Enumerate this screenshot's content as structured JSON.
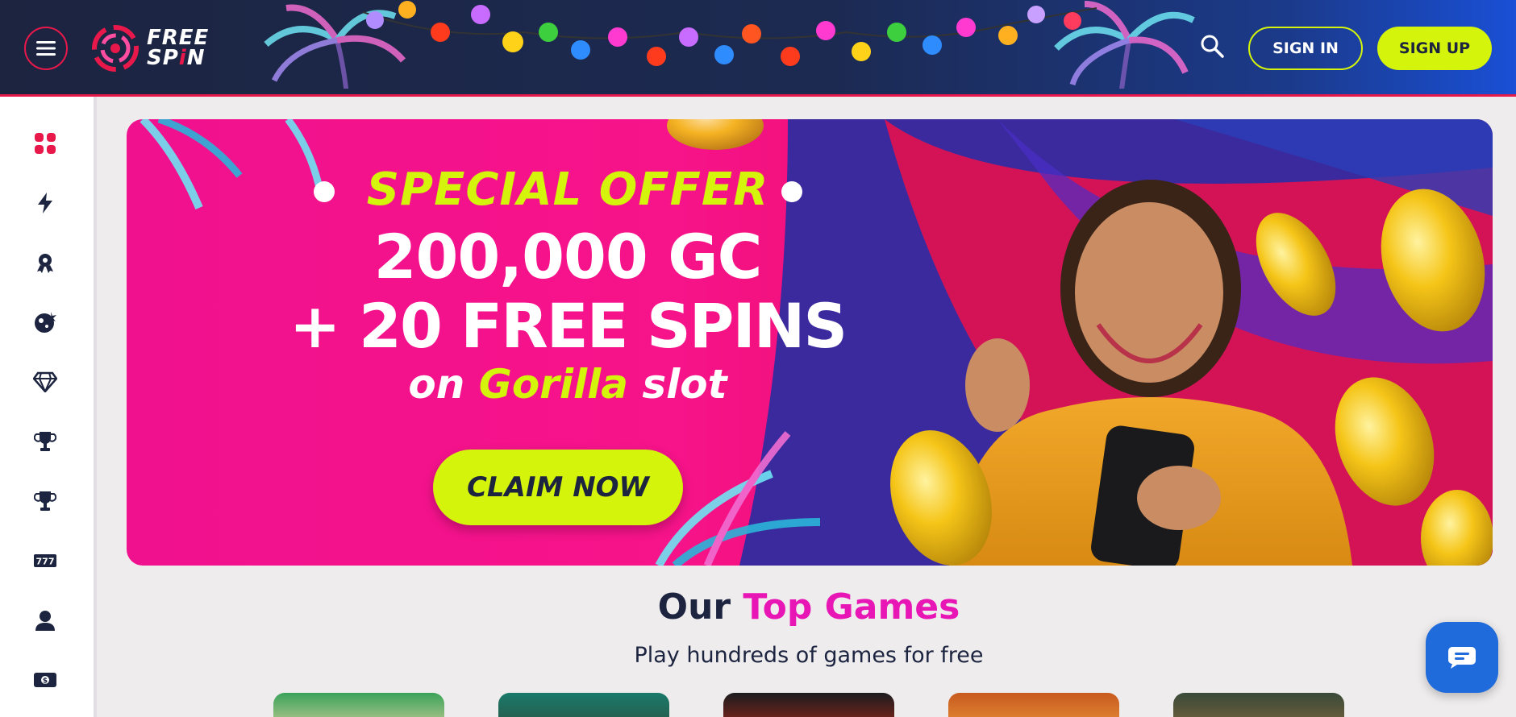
{
  "header": {
    "logo_line1": "FREE",
    "logo_line2_a": "SP",
    "logo_line2_b": "i",
    "logo_line2_c": "N",
    "menu_icon": "hamburger-icon",
    "search_icon": "search-icon",
    "signin_label": "SIGN IN",
    "signup_label": "SIGN UP"
  },
  "sidebar": {
    "items": [
      {
        "icon": "grid-icon",
        "color": "#e8184a"
      },
      {
        "icon": "lightning-icon",
        "color": "#1c2440"
      },
      {
        "icon": "award-ribbon-icon",
        "color": "#1c2440"
      },
      {
        "icon": "crazy-ball-icon",
        "color": "#1c2440"
      },
      {
        "icon": "diamond-icon",
        "color": "#1c2440"
      },
      {
        "icon": "trophy-icon",
        "color": "#1c2440"
      },
      {
        "icon": "trophy-icon",
        "color": "#1c2440"
      },
      {
        "icon": "slots-777-icon",
        "color": "#1c2440"
      },
      {
        "icon": "user-icon",
        "color": "#1c2440"
      },
      {
        "icon": "cash-icon",
        "color": "#1c2440"
      }
    ]
  },
  "banner": {
    "line1": "SPECIAL OFFER",
    "line2": "200,000 GC",
    "line3": "+ 20 FREE SPINS",
    "line4_a": "on ",
    "line4_b": "Gorilla",
    "line4_c": " slot",
    "cta_label": "CLAIM NOW"
  },
  "top_games": {
    "title_a": "Our ",
    "title_b": "Top Games",
    "subtitle": "Play hundreds of games for free"
  },
  "colors": {
    "brand_red": "#e8184a",
    "accent_lime": "#d4f40b",
    "accent_pink": "#e816b4",
    "navy": "#1c2440",
    "chat_blue": "#1f6bdb"
  },
  "chat": {
    "icon": "chat-bubble-icon"
  }
}
